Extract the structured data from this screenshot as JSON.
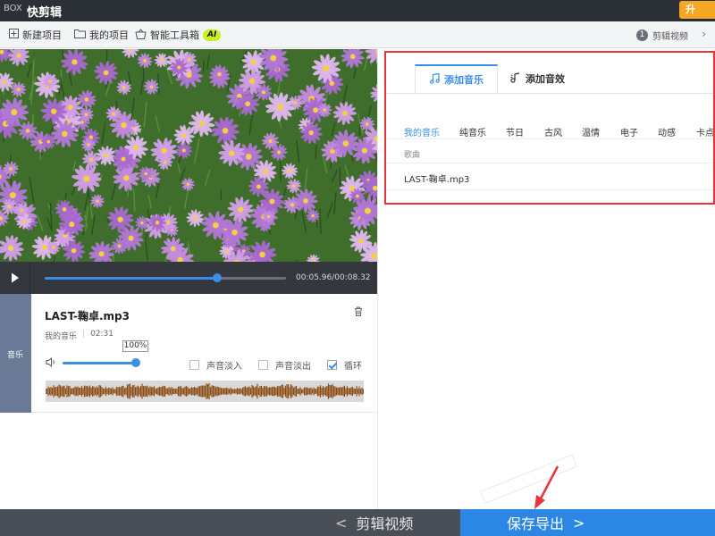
{
  "titlebar": {
    "logo": "BOX",
    "title": "快剪辑",
    "upgrade_label": "升"
  },
  "toolbar": {
    "new_project": "新建项目",
    "my_projects": "我的项目",
    "smart_toolbox": "智能工具箱",
    "ai_badge": "AI",
    "step_number": "1",
    "step_label": "剪辑视频"
  },
  "player": {
    "timecode": "00:05.96/00:08.32",
    "progress_fraction": 0.715
  },
  "music_panel": {
    "side_tab": "音乐",
    "track_name": "LAST-鞠卓.mp3",
    "source": "我的音乐",
    "duration": "02:31",
    "volume_label": "100%",
    "volume_fraction": 1.0,
    "fade_in": "声音淡入",
    "fade_in_checked": false,
    "fade_out": "声音淡出",
    "fade_out_checked": false,
    "loop": "循环",
    "loop_checked": true
  },
  "right_panel": {
    "tab_music": "添加音乐",
    "tab_effects": "添加音效",
    "categories": [
      "我的音乐",
      "纯音乐",
      "节日",
      "古风",
      "温情",
      "电子",
      "动感",
      "卡点"
    ],
    "active_category": 0,
    "list_header": "歌曲",
    "songs": [
      "LAST-鞠卓.mp3"
    ]
  },
  "bottombar": {
    "back_label": "剪辑视频",
    "export_label": "保存导出"
  },
  "colors": {
    "accent": "#2b87e3",
    "highlight_border": "#e5353a",
    "titlebar": "#2b2f36"
  }
}
